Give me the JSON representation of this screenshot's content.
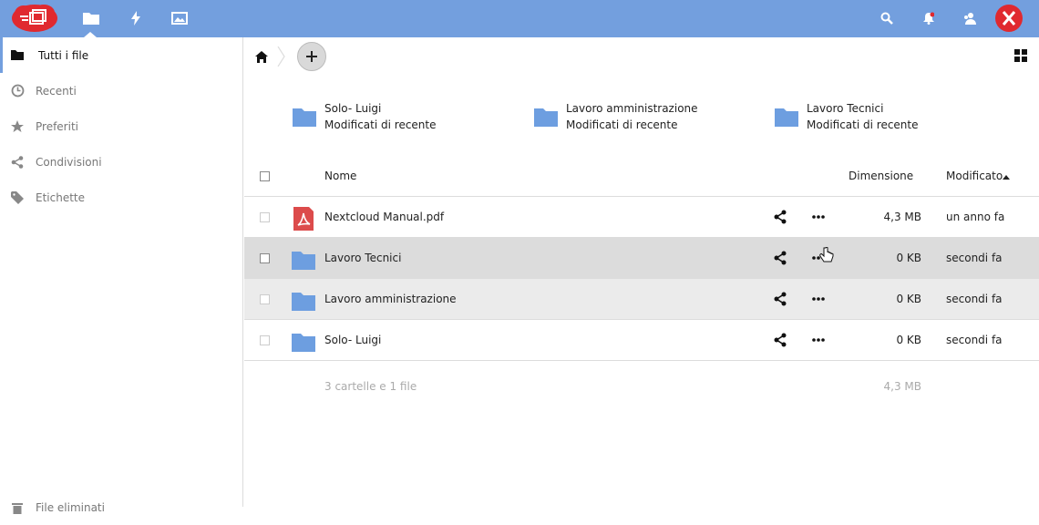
{
  "header": {
    "apps": [
      {
        "name": "files",
        "icon": "folder-icon"
      },
      {
        "name": "activity",
        "icon": "lightning-icon"
      },
      {
        "name": "gallery",
        "icon": "image-icon"
      }
    ],
    "right_icons": [
      "search-icon",
      "bell-icon",
      "contacts-icon"
    ],
    "avatar_icon": "avatar-x-icon",
    "accent_color": "#739fde"
  },
  "sidebar": {
    "items": [
      {
        "label": "Tutti i file",
        "icon": "folder-icon"
      },
      {
        "label": "Recenti",
        "icon": "clock-icon"
      },
      {
        "label": "Preferiti",
        "icon": "star-icon"
      },
      {
        "label": "Condivisioni",
        "icon": "share-icon"
      },
      {
        "label": "Etichette",
        "icon": "tag-icon"
      }
    ],
    "trash_label": "File eliminati"
  },
  "recent": [
    {
      "name": "Solo- Luigi",
      "sub": "Modificati di recente"
    },
    {
      "name": "Lavoro amministrazione",
      "sub": "Modificati di recente"
    },
    {
      "name": "Lavoro Tecnici",
      "sub": "Modificati di recente"
    }
  ],
  "table": {
    "headers": {
      "name": "Nome",
      "size": "Dimensione",
      "modified": "Modificato"
    },
    "rows": [
      {
        "name": "Nextcloud Manual.pdf",
        "type": "pdf",
        "size": "4,3 MB",
        "modified": "un anno fa"
      },
      {
        "name": "Lavoro Tecnici",
        "type": "folder",
        "size": "0 KB",
        "modified": "secondi fa"
      },
      {
        "name": "Lavoro amministrazione",
        "type": "folder",
        "size": "0 KB",
        "modified": "secondi fa"
      },
      {
        "name": "Solo- Luigi",
        "type": "folder",
        "size": "0 KB",
        "modified": "secondi fa"
      }
    ],
    "summary": "3 cartelle e 1 file",
    "summary_size": "4,3 MB"
  }
}
